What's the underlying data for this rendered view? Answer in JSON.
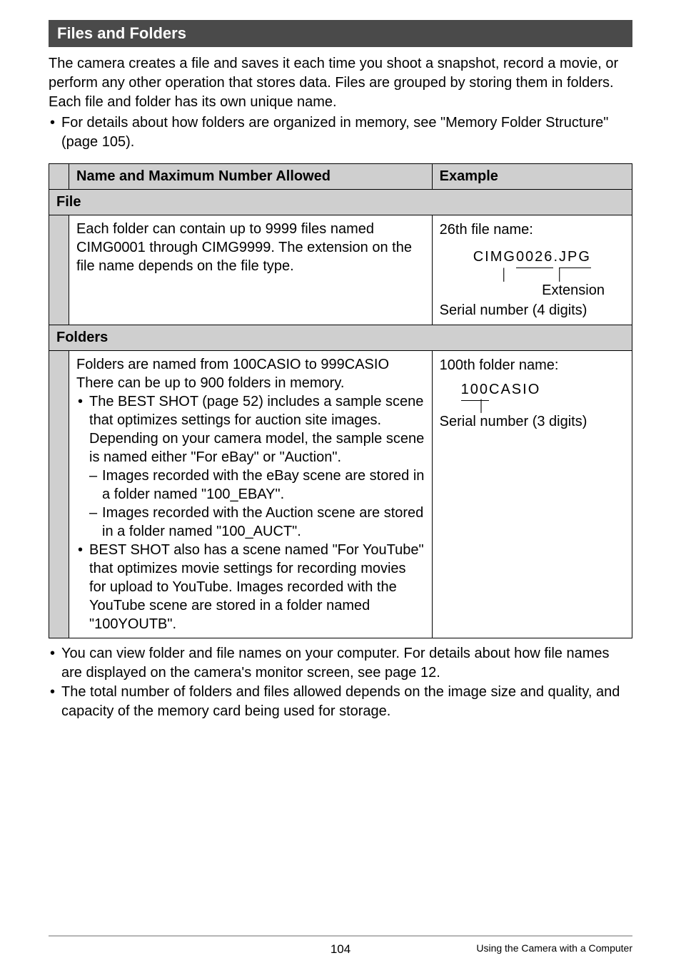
{
  "section_title": "Files and Folders",
  "intro_text": "The camera creates a file and saves it each time you shoot a snapshot, record a movie, or perform any other operation that stores data. Files are grouped by storing them in folders. Each file and folder has its own unique name.",
  "intro_bullet": "For details about how folders are organized in memory, see \"Memory Folder Structure\" (page 105).",
  "table": {
    "header_left": "Name and Maximum Number Allowed",
    "header_right": "Example",
    "file_label": "File",
    "file_desc": "Each folder can contain up to 9999 files named CIMG0001 through CIMG9999. The extension on the file name depends on the file type.",
    "file_example_title": "26th file name:",
    "file_example_p1": "CIMG",
    "file_example_p2": "0026",
    "file_example_dot": ".",
    "file_example_p3": "JPG",
    "file_ext_label": "Extension",
    "file_serial_label": "Serial number (4 digits)",
    "folders_label": "Folders",
    "folders_line1": "Folders are named from 100CASIO to 999CASIO",
    "folders_line2": "There can be up to 900 folders in memory.",
    "folders_b1": "The BEST SHOT (page 52) includes a sample scene that optimizes settings for auction site images. Depending on your camera model, the sample scene is named either \"For eBay\" or \"Auction\".",
    "folders_d1": "Images recorded with the eBay scene are stored in a folder named \"100_EBAY\".",
    "folders_d2": "Images recorded with the Auction scene are stored in a folder named \"100_AUCT\".",
    "folders_b2": "BEST SHOT also has a scene named \"For YouTube\" that optimizes movie settings for recording movies for upload to YouTube. Images recorded with the YouTube scene are stored in a folder named \"100YOUTB\".",
    "folder_example_title": "100th folder name:",
    "folder_example_p1": "100",
    "folder_example_p2": "CASIO",
    "folder_serial_label": "Serial number (3 digits)"
  },
  "notes_b1": "You can view folder and file names on your computer. For details about how file names are displayed on the camera's monitor screen, see page 12.",
  "notes_b2": "The total number of folders and files allowed depends on the image size and quality, and capacity of the memory card being used for storage.",
  "page_number": "104",
  "footer_right": "Using the Camera with a Computer"
}
